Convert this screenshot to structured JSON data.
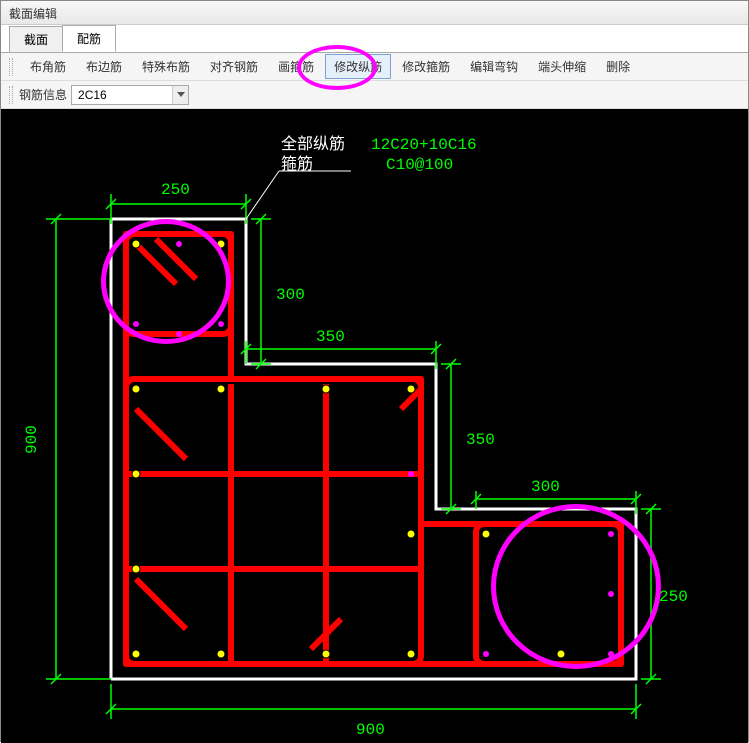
{
  "window": {
    "title": "截面编辑"
  },
  "tabs": [
    {
      "label": "截面",
      "active": false
    },
    {
      "label": "配筋",
      "active": true
    }
  ],
  "toolbar": {
    "items": [
      {
        "label": "布角筋"
      },
      {
        "label": "布边筋"
      },
      {
        "label": "特殊布筋"
      },
      {
        "label": "对齐钢筋"
      },
      {
        "label": "画箍筋"
      },
      {
        "label": "修改纵筋",
        "highlighted": true
      },
      {
        "label": "修改箍筋"
      },
      {
        "label": "编辑弯钩"
      },
      {
        "label": "端头伸缩"
      },
      {
        "label": "删除"
      }
    ]
  },
  "inputbar": {
    "label": "钢筋信息",
    "value": "2C16"
  },
  "drawing": {
    "info": {
      "label1": "全部纵筋",
      "value1": "12C20+10C16",
      "label2": "箍筋",
      "value2": "C10@100"
    },
    "dimensions": {
      "d250_top": "250",
      "d300_right1": "300",
      "d350_top": "350",
      "d350_right2": "350",
      "d300_top": "300",
      "d250_right3": "250",
      "d900_left": "900",
      "d900_bottom": "900"
    }
  }
}
